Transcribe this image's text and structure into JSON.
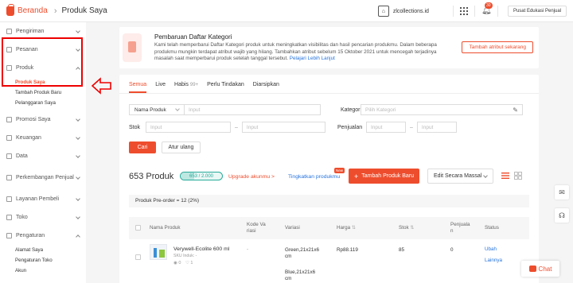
{
  "header": {
    "app_name": "Beranda",
    "breadcrumb_sep": "›",
    "page_title": "Produk Saya",
    "shop_name": "zlcollections.id",
    "notification_count": "30",
    "help_label": "Pusat Edukasi Penjual",
    "brand_color": "#ee4d2d"
  },
  "sidebar": {
    "sections": [
      {
        "label": "Pengiriman",
        "icon": "truck-icon"
      },
      {
        "label": "Pesanan",
        "icon": "orders-icon"
      },
      {
        "label": "Produk",
        "icon": "product-icon",
        "sub": [
          "Produk Saya",
          "Tambah Produk Baru",
          "Pelanggaran Saya"
        ]
      },
      {
        "label": "Promosi Saya",
        "icon": "promo-icon"
      },
      {
        "label": "Keuangan",
        "icon": "finance-icon"
      },
      {
        "label": "Data",
        "icon": "data-icon"
      },
      {
        "label": "Perkembangan Penjual",
        "icon": "growth-icon"
      },
      {
        "label": "Layanan Pembeli",
        "icon": "service-icon"
      },
      {
        "label": "Toko",
        "icon": "shop-icon"
      },
      {
        "label": "Pengaturan",
        "icon": "settings-icon",
        "sub": [
          "Alamat Saya",
          "Pengaturan Toko",
          "Akun"
        ]
      }
    ]
  },
  "notice": {
    "title": "Pembaruan Daftar Kategori",
    "body": "Kami telah memperbarui Daftar Kategori produk untuk meningkatkan visibilitas dan hasil pencarian produkmu. Dalam beberapa produkmu mungkin terdapat atribut wajib yang hilang. Tambahkan atribut sebelum 15 Oktober 2021 untuk mencegah terjadinya masalah saat memperbarui produk setelah tanggal tersebut.",
    "link": "Pelajari Lebih Lanjut",
    "button": "Tambah atribut sekarang"
  },
  "tabs": [
    {
      "label": "Semua",
      "count": ""
    },
    {
      "label": "Live",
      "count": ""
    },
    {
      "label": "Habis",
      "count": "99+"
    },
    {
      "label": "Perlu Tindakan",
      "count": ""
    },
    {
      "label": "Diarsipkan",
      "count": ""
    }
  ],
  "filters": {
    "name_select": "Nama Produk",
    "name_placeholder": "Input",
    "category_label": "Kategori",
    "category_placeholder": "Pilih Kategori",
    "stock_label": "Stok",
    "sales_label": "Penjualan",
    "range_placeholder": "Input",
    "dash": "–",
    "search_button": "Cari",
    "reset_button": "Atur ulang"
  },
  "summary": {
    "count_title": "653 Produk",
    "quota_text": "653 / 2.000",
    "quota_fraction": 0.3265,
    "upgrade_link": "Upgrade akunmu >",
    "tingkatkan_link": "Tingkatkan produkmu",
    "new_badge": "New",
    "add_button": "Tambah Produk Baru",
    "bulk_button": "Edit Secara Massal"
  },
  "preorder": "Produk Pre-order = 12 (2%)",
  "table": {
    "headers": {
      "name": "Nama Produk",
      "variation_code": "Kode Va\nriasi",
      "variation": "Variasi",
      "price": "Harga",
      "stock": "Stok",
      "sales": "Penjuala\nn",
      "status": "Status"
    },
    "rows": [
      {
        "name": "Verywell-Ecolite 600 ml",
        "sku": "SKU Induk: -",
        "views": "0",
        "likes": "1",
        "code": "-",
        "variation_1": "Green,21x21x6 cm",
        "variation_2": "Blue,21x21x6 cm",
        "price": "Rp88.119",
        "stock": "85",
        "sales": "0",
        "action_1": "Ubah",
        "action_2": "Lainnya"
      }
    ]
  },
  "chat_label": "Chat"
}
